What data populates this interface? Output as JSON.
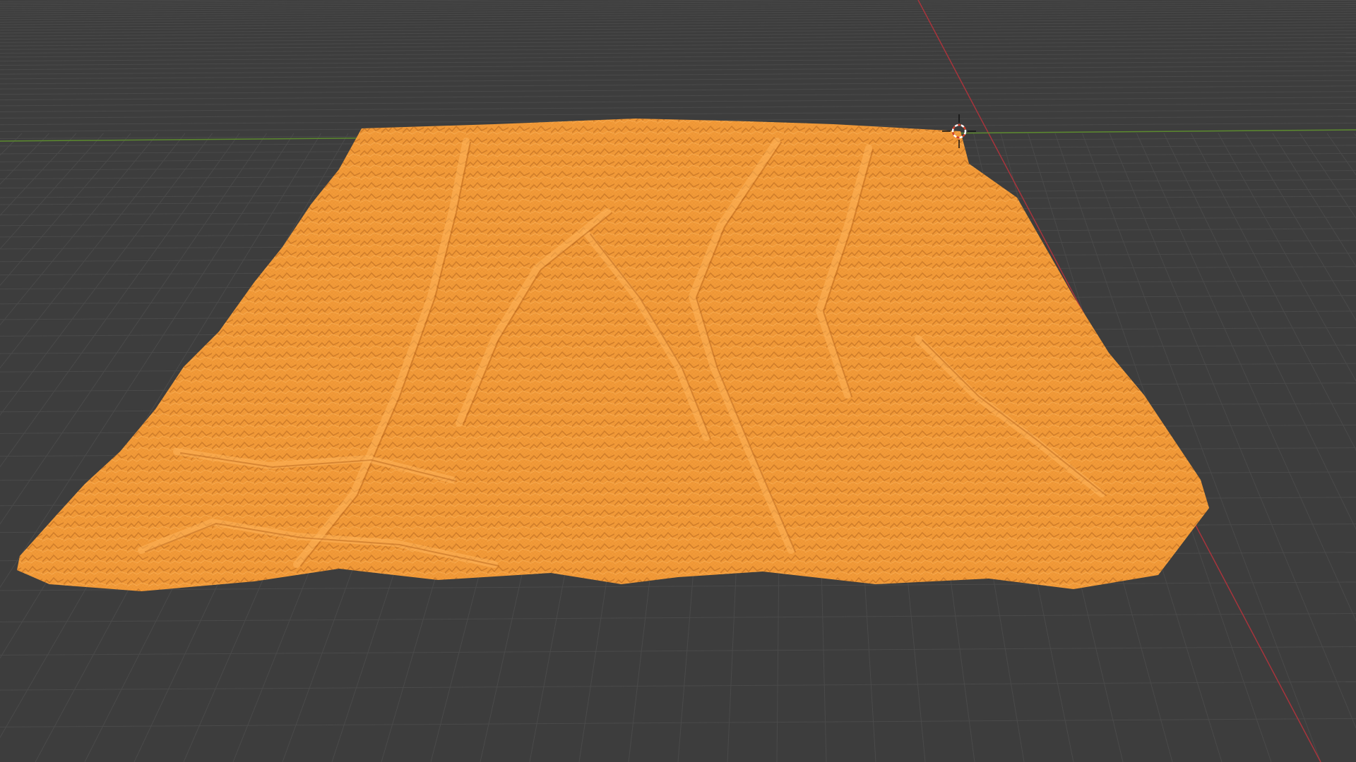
{
  "app": {
    "editor": "3D Viewport",
    "view": "perspective"
  },
  "scene": {
    "background_color": "#3d3d3d",
    "grid_color": "#4a4a4a",
    "x_axis_color": "#a8343c",
    "y_axis_color": "#5c8a2e",
    "object": {
      "type": "terrain-mesh",
      "mode": "edit-wireframe",
      "selected": true,
      "color": "#f29a38",
      "shadow_color": "#b8641c",
      "highlight_color": "#ffb45a"
    },
    "cursor": {
      "name": "3d-cursor"
    }
  }
}
